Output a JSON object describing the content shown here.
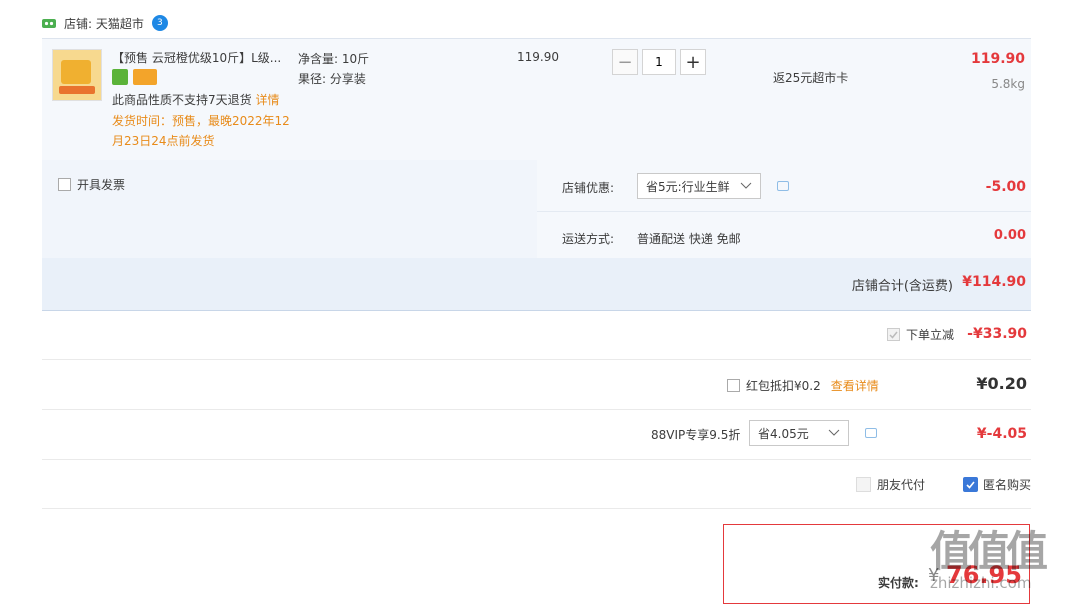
{
  "store": {
    "label": "店铺: 天猫超市",
    "badge": "3"
  },
  "item": {
    "title": "【预售 云冠橙优级10斤】L级...",
    "net_weight": "净含量: 10斤",
    "diameter": "果径: 分享装",
    "notice": "此商品性质不支持7天退货",
    "notice_link": "详情",
    "ship_line1": "发货时间：预售，最晚2022年12",
    "ship_line2": "月23日24点前发货",
    "unit_price": "119.90",
    "qty": "1",
    "rebate": "返25元超市卡",
    "total": "119.90",
    "weight": "5.8kg"
  },
  "invoice_label": "开具发票",
  "store_discount": {
    "label": "店铺优惠:",
    "selected": "省5元:行业生鲜",
    "amount": "-5.00"
  },
  "shipping": {
    "label": "运送方式:",
    "value": "普通配送 快递 免邮",
    "amount": "0.00"
  },
  "store_total": {
    "label": "店铺合计(含运费)",
    "amount": "¥114.90"
  },
  "instant_discount": {
    "label": "下单立减",
    "amount": "-¥33.90"
  },
  "red_packet": {
    "label": "红包抵扣¥0.2",
    "link": "查看详情",
    "amount": "¥0.20"
  },
  "vip": {
    "label": "88VIP专享9.5折",
    "selected": "省4.05元",
    "amount": "¥-4.05"
  },
  "friend_pay": "朋友代付",
  "anonymous": "匿名购买",
  "payment": {
    "label": "实付款:",
    "currency": "¥",
    "amount": "76.95"
  },
  "watermark": {
    "text": "值值值",
    "sub": "zhizhizhi.com"
  },
  "colors": {
    "accent_red": "#e4393c",
    "link_orange": "#e88b1a",
    "checked_blue": "#3a78d8"
  }
}
